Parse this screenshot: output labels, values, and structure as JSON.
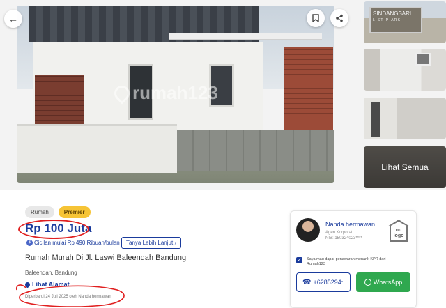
{
  "gallery": {
    "watermark": "rumah123",
    "thumb1_sign": "SINDANGSARI",
    "thumb1_sign_small": "L I S T · P · A R K",
    "see_all_label": "Lihat Semua"
  },
  "listing": {
    "tags": [
      "Rumah",
      "Premier"
    ],
    "price": "Rp 100 Juta",
    "installment": "Cicilan mulai Rp 490 Ribuan/bulan",
    "ask_more_label": "Tanya Lebih Lanjut",
    "title": "Rumah Murah Di Jl. Laswi Baleendah Bandung",
    "location": "Baleendah, Bandung",
    "see_address_label": "Lihat Alamat",
    "updated": "Diperbarui 24 Juli 2025 oleh Nanda hermawan"
  },
  "agent": {
    "name": "Nanda hermawan",
    "role": "Agen Korporat",
    "nib": "NIB: 150324023****",
    "logo_text": "no logo",
    "kpr_text": "Saya mau dapat penawaran menarik KPR dari Rumah123",
    "phone_label": "+6285294:",
    "whatsapp_label": "WhatsApp"
  },
  "icons": {
    "back": "arrow-left-icon",
    "bookmark": "bookmark-icon",
    "share": "share-icon"
  },
  "colors": {
    "brand_blue": "#1a3b9c",
    "premier_yellow": "#f6c436",
    "whatsapp_green": "#2fa84f",
    "annotation_red": "#e02020"
  }
}
